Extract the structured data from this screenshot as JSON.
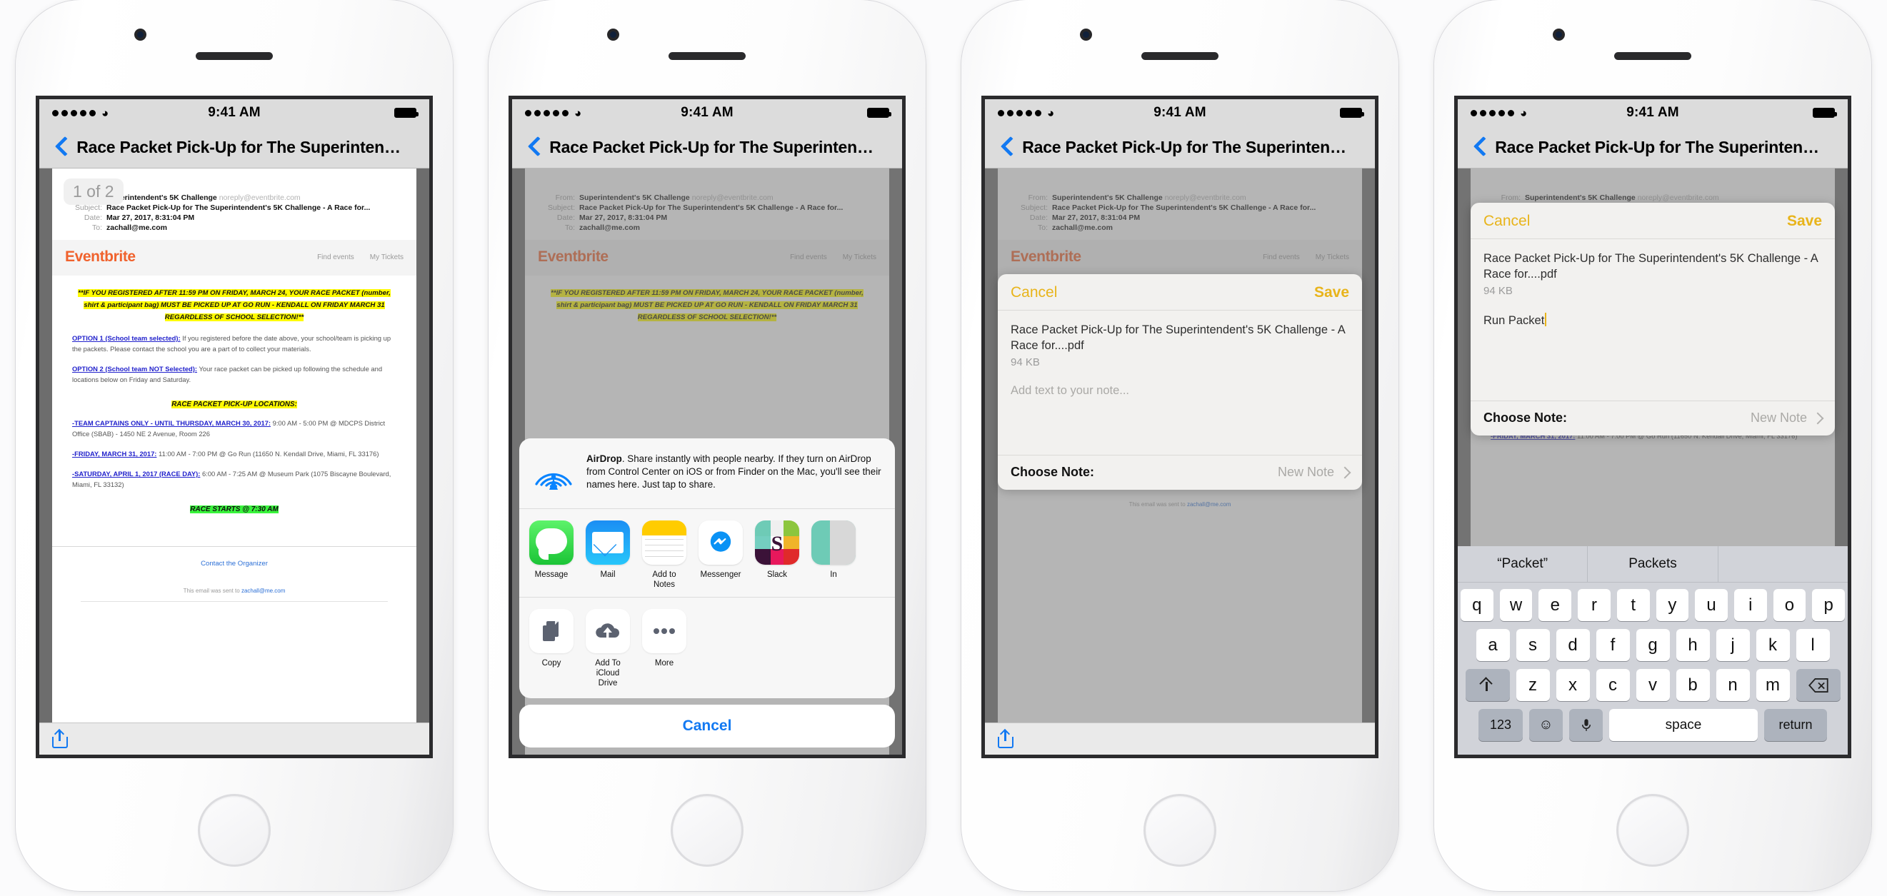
{
  "status_bar": {
    "time": "9:41 AM",
    "signal_dots": 5,
    "wifi_icon": "wifi-icon",
    "battery_icon": "battery-full-icon"
  },
  "nav": {
    "title": "Race Packet Pick-Up for The Superinten…",
    "back_icon": "chevron-left-icon"
  },
  "mail": {
    "page_count": "1 of 2",
    "headers": [
      {
        "label": "",
        "value": "Superintendent's 5K Challenge",
        "extra": "noreply@eventbrite.com"
      },
      {
        "label": "Subject:",
        "value": "Race Packet Pick-Up for The Superintendent's 5K Challenge - A Race for...",
        "extra": ""
      },
      {
        "label": "Date:",
        "value": "Mar 27, 2017, 8:31:04 PM",
        "extra": ""
      },
      {
        "label": "To:",
        "value": "zachall@me.com",
        "extra": ""
      }
    ],
    "brand": "Eventbrite",
    "brand_color": "#f0622d",
    "nav_links": [
      "Find events",
      "My Tickets"
    ],
    "highlight_notice": "**IF YOU REGISTERED AFTER 11:59 PM ON FRIDAY, MARCH 24, YOUR RACE PACKET (number, shirt & participant bag) MUST BE PICKED UP AT GO RUN - KENDALL ON FRIDAY MARCH 31 REGARDLESS OF SCHOOL SELECTION!**",
    "option1_title": "OPTION 1 (School team selected):",
    "option1_body": "If you registered before the date above, your school/team is picking up the packets. Please contact the school you are a part of to collect your materials.",
    "option2_title": "OPTION 2 (School team NOT Selected):",
    "option2_body": "Your race packet can be picked up following the schedule and locations below on Friday and Saturday.",
    "locations_heading": "RACE PACKET PICK-UP LOCATIONS:",
    "locations": [
      {
        "title": "-TEAM CAPTAINS ONLY - UNTIL THURSDAY, MARCH 30, 2017:",
        "detail": "9:00 AM - 5:00 PM @ MDCPS District Office (SBAB) - 1450 NE 2 Avenue, Room 226"
      },
      {
        "title": "-FRIDAY, MARCH 31, 2017:",
        "detail": "11:00 AM - 7:00 PM @ Go Run (11650 N. Kendall Drive, Miami, FL 33176)"
      },
      {
        "title": "-SATURDAY, APRIL 1, 2017 (RACE DAY):",
        "detail": "6:00 AM - 7:25 AM @ Museum Park (1075 Biscayne Boulevard, Miami, FL 33132)"
      }
    ],
    "race_start": "RACE STARTS @ 7:30 AM",
    "contact_organizer": "Contact the Organizer",
    "email_sent_to_prefix": "This email was sent to ",
    "email_sent_to_address": "zachall@me.com",
    "toolbar_share_icon": "share-icon"
  },
  "share_sheet": {
    "airdrop_icon": "airdrop-icon",
    "airdrop_title": "AirDrop",
    "airdrop_text": ". Share instantly with people nearby. If they turn on AirDrop from Control Center on iOS or from Finder on the Mac, you'll see their names here. Just tap to share.",
    "apps": [
      {
        "label": "Message",
        "icon": "messages-app-icon"
      },
      {
        "label": "Mail",
        "icon": "mail-app-icon"
      },
      {
        "label": "Add to Notes",
        "icon": "notes-app-icon"
      },
      {
        "label": "Messenger",
        "icon": "messenger-app-icon"
      },
      {
        "label": "Slack",
        "icon": "slack-app-icon"
      },
      {
        "label": "In",
        "icon": "instagram-app-icon"
      }
    ],
    "actions": [
      {
        "label": "Copy",
        "icon": "copy-icon"
      },
      {
        "label": "Add To iCloud Drive",
        "icon": "icloud-upload-icon"
      },
      {
        "label": "More",
        "icon": "more-dots-icon"
      }
    ],
    "cancel_label": "Cancel"
  },
  "note_dialog": {
    "cancel_label": "Cancel",
    "save_label": "Save",
    "filename": "Race Packet Pick-Up for The Superintendent's 5K Challenge - A Race for....pdf",
    "filesize": "94 KB",
    "placeholder": "Add text to your note...",
    "typed_text": "Run Packet",
    "choose_note_label": "Choose Note:",
    "selected_note": "New Note",
    "chevron_icon": "chevron-right-icon",
    "accent_color": "#e8b41b"
  },
  "keyboard": {
    "predictions": [
      "“Packet”",
      "Packets"
    ],
    "row1": [
      "q",
      "w",
      "e",
      "r",
      "t",
      "y",
      "u",
      "i",
      "o",
      "p"
    ],
    "row2": [
      "a",
      "s",
      "d",
      "f",
      "g",
      "h",
      "j",
      "k",
      "l"
    ],
    "row3": [
      "z",
      "x",
      "c",
      "v",
      "b",
      "n",
      "m"
    ],
    "shift_icon": "shift-icon",
    "delete_icon": "delete-backward-icon",
    "numbers_label": "123",
    "emoji_icon": "emoji-icon",
    "mic_icon": "microphone-icon",
    "space_label": "space",
    "return_label": "return"
  }
}
